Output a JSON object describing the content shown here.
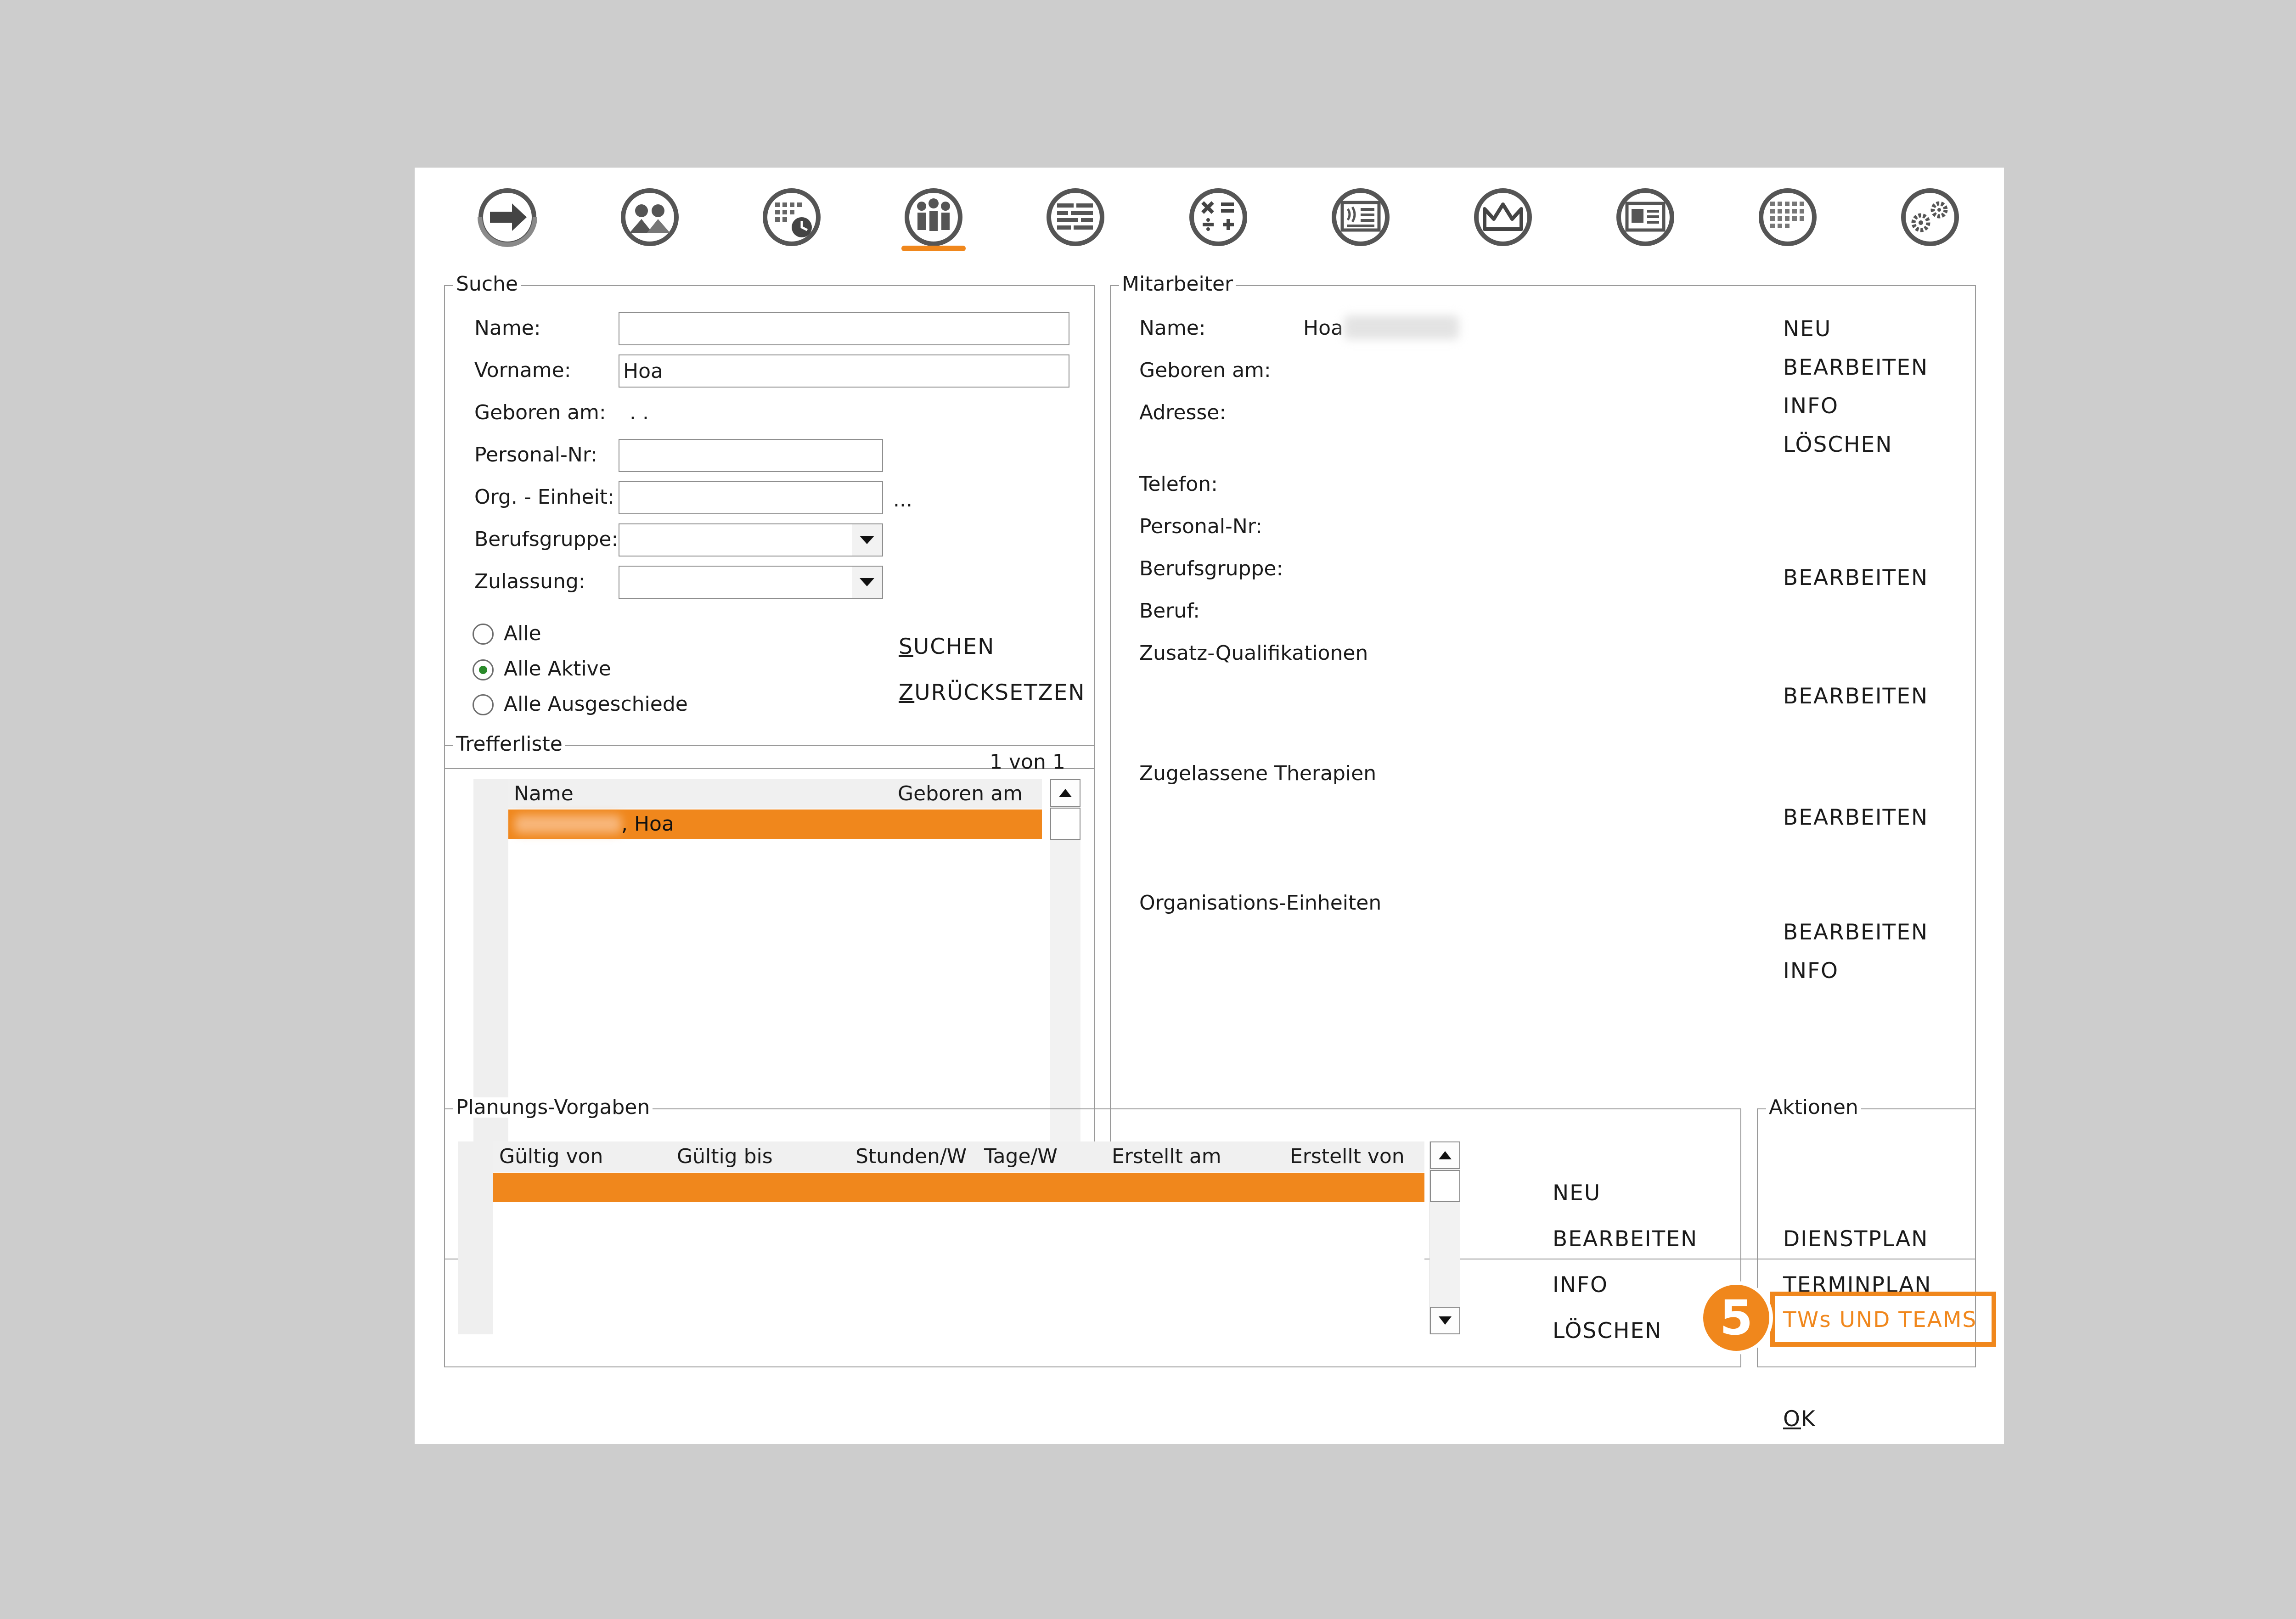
{
  "toolbar": {
    "icons": [
      "arrow-right-icon",
      "persons-icon",
      "calendar-clock-icon",
      "team-icon",
      "list-lines-icon",
      "calculator-icon",
      "document-sound-icon",
      "crown-icon",
      "id-card-icon",
      "calendar-grid-icon",
      "gears-icon"
    ],
    "active_index": 3
  },
  "suche": {
    "title": "Suche",
    "name_label": "Name:",
    "name_value": "",
    "vorname_label": "Vorname:",
    "vorname_value": "Hoa",
    "geboren_label": "Geboren am:",
    "geboren_value": ". .",
    "personal_label": "Personal-Nr:",
    "personal_value": "",
    "org_label": "Org. - Einheit:",
    "org_value": "",
    "org_more": "...",
    "berufsgruppe_label": "Berufsgruppe:",
    "berufsgruppe_value": "",
    "zulassung_label": "Zulassung:",
    "zulassung_value": "",
    "radio_alle": "Alle",
    "radio_aktive": "Alle Aktive",
    "radio_ausgeschiede": "Alle Ausgeschiede",
    "selected_radio": "Alle Aktive",
    "suchen_first": "S",
    "suchen_rest": "UCHEN",
    "zurueck_first": "Z",
    "zurueck_rest": "URÜCKSETZEN"
  },
  "trefferliste": {
    "title": "Trefferliste",
    "count": "1 von 1",
    "col_name": "Name",
    "col_geboren": "Geboren am",
    "rows": [
      {
        "name_visible": ", Hoa",
        "geboren": ""
      }
    ]
  },
  "mitarbeiter": {
    "title": "Mitarbeiter",
    "name_label": "Name:",
    "name_value": "Hoa",
    "geboren_label": "Geboren am:",
    "adresse_label": "Adresse:",
    "telefon_label": "Telefon:",
    "personal_label": "Personal-Nr:",
    "berufsgruppe_label": "Berufsgruppe:",
    "beruf_label": "Beruf:",
    "zusatz_label": "Zusatz-Qualifikationen",
    "therapien_label": "Zugelassene Therapien",
    "org_label": "Organisations-Einheiten",
    "actions": {
      "neu": "NEU",
      "bearbeiten": "BEARBEITEN",
      "info": "INFO",
      "loeschen": "LÖSCHEN"
    }
  },
  "planung": {
    "title": "Planungs-Vorgaben",
    "columns": [
      "Gültig von",
      "Gültig bis",
      "Stunden/W",
      "Tage/W",
      "Erstellt am",
      "Erstellt von"
    ],
    "actions": {
      "neu": "NEU",
      "bearbeiten": "BEARBEITEN",
      "info": "INFO",
      "loeschen": "LÖSCHEN"
    }
  },
  "aktionen": {
    "title": "Aktionen",
    "dienstplan": "DIENSTPLAN",
    "terminplan": "TERMINPLAN",
    "tws_teams": "TWs UND TEAMS"
  },
  "ok_first": "O",
  "ok_rest": "K",
  "callout": {
    "number": "5"
  },
  "colors": {
    "accent": "#f0871c",
    "background": "#cdcdcd",
    "window": "#ffffff"
  }
}
